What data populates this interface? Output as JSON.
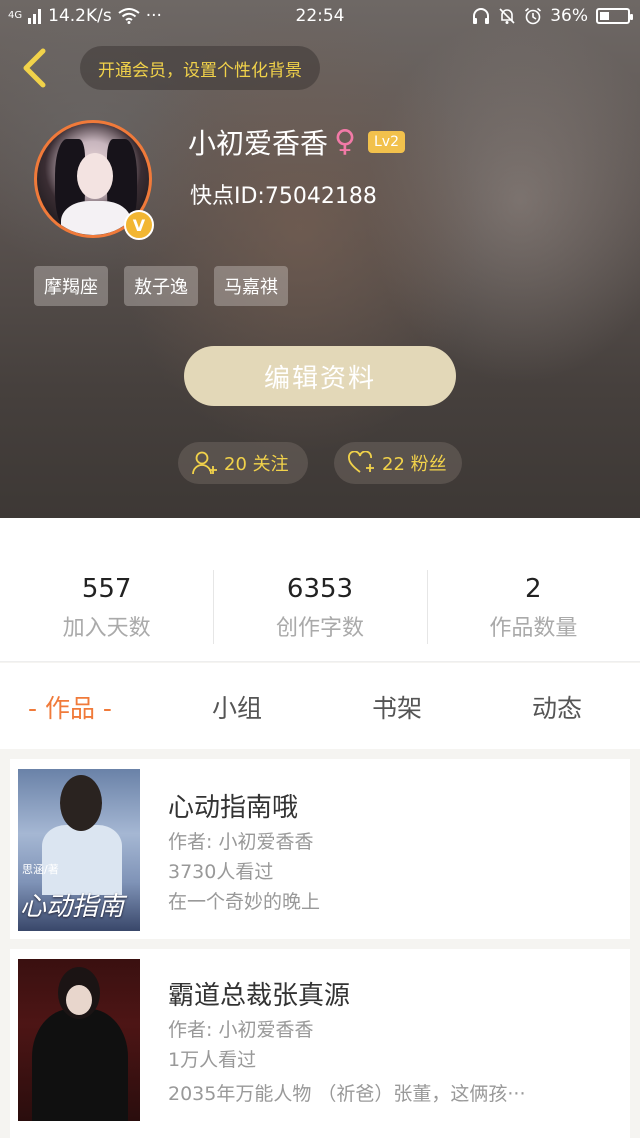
{
  "status_bar": {
    "network": "4G",
    "speed": "14.2K/s",
    "dots": "···",
    "time": "22:54",
    "battery": "36%",
    "battery_level": 0.36
  },
  "header": {
    "vip_prompt": "开通会员，设置个性化背景",
    "username": "小初爱香香",
    "gender_symbol": "♀",
    "level": "Lv2",
    "user_id": "快点ID:75042188",
    "avatar_badge": "V",
    "tags": [
      "摩羯座",
      "敖子逸",
      "马嘉祺"
    ],
    "edit_button": "编辑资料",
    "following": "20 关注",
    "fans": "22 粉丝"
  },
  "stats": [
    {
      "value": "557",
      "label": "加入天数"
    },
    {
      "value": "6353",
      "label": "创作字数"
    },
    {
      "value": "2",
      "label": "作品数量"
    }
  ],
  "tabs": [
    {
      "label": "- 作品 -",
      "active": true
    },
    {
      "label": "小组",
      "active": false
    },
    {
      "label": "书架",
      "active": false
    },
    {
      "label": "动态",
      "active": false
    }
  ],
  "works": [
    {
      "title": "心动指南哦",
      "author": "作者: 小初爱香香",
      "views": "3730人看过",
      "summary": "在一个奇妙的晚上",
      "cover_title": "心动指南",
      "cover_author": "思涵/著"
    },
    {
      "title": "霸道总裁张真源",
      "author": "作者: 小初爱香香",
      "views": "1万人看过",
      "summary": "2035年万能人物 （祈爸）张董，这俩孩···"
    }
  ],
  "colors": {
    "accent_orange": "#f07a3a",
    "gold_text": "#f1d24a",
    "edit_button_bg": "#e3d8b8"
  }
}
